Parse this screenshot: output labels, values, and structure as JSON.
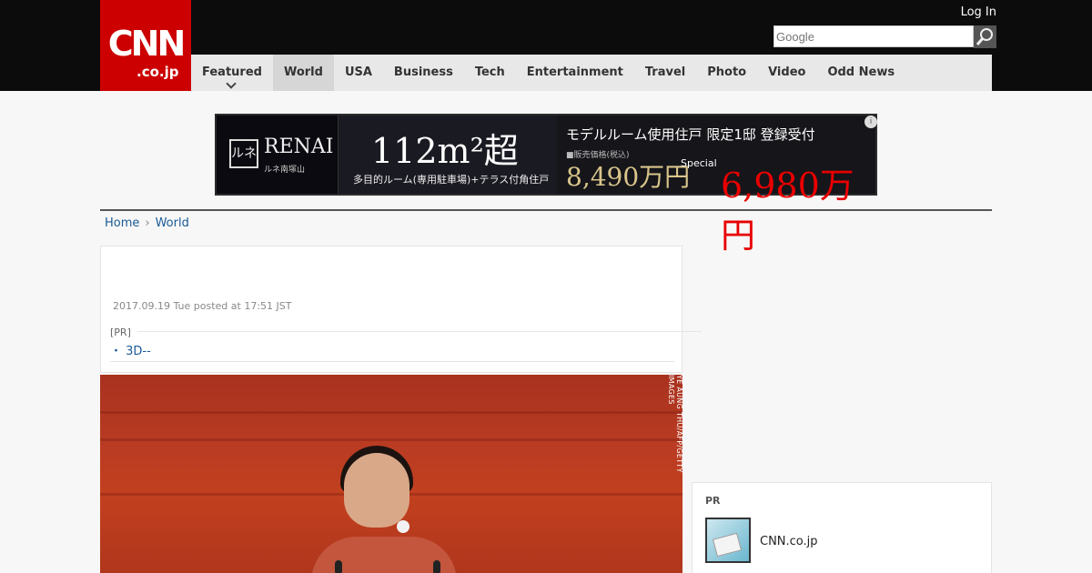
{
  "header": {
    "logo_main": "CNN",
    "logo_sub": ".co.jp",
    "login": "Log In",
    "search_placeholder": "Google"
  },
  "nav": {
    "items": [
      {
        "label": "Featured"
      },
      {
        "label": "World"
      },
      {
        "label": "USA"
      },
      {
        "label": "Business"
      },
      {
        "label": "Tech"
      },
      {
        "label": "Entertainment"
      },
      {
        "label": "Travel"
      },
      {
        "label": "Photo"
      },
      {
        "label": "Video"
      },
      {
        "label": "Odd News"
      }
    ]
  },
  "ad": {
    "brand_logo": "ルネ",
    "brand": "RENAI",
    "brand_sub": "ルネ南塚山",
    "size": "112m²超",
    "sub": "多目的ルーム(専用駐車場)+テラス付角住戸",
    "right_title": "モデルルーム使用住戸 限定1邸 登録受付",
    "right_note": "■販売価格(税込)",
    "price_old": "8,490万円",
    "price_label": "Special",
    "price_new": "6,980万円"
  },
  "breadcrumb": {
    "home": "Home",
    "section": "World"
  },
  "article": {
    "posted": "2017.09.19 Tue posted at 17:51 JST",
    "pr_label": "[PR]",
    "pr_link": "・ 3D--"
  },
  "photo": {
    "credit": "YE AUNG THU/AFP/GETTY IMAGES"
  },
  "sidebar": {
    "pr_label": "PR",
    "item_title": "CNN.co.jp"
  },
  "colors": {
    "brand_red": "#cc0000",
    "link_blue": "#1a5a96",
    "topbar_bg": "#0c0c0c",
    "nav_bg": "#e8e8e8"
  }
}
